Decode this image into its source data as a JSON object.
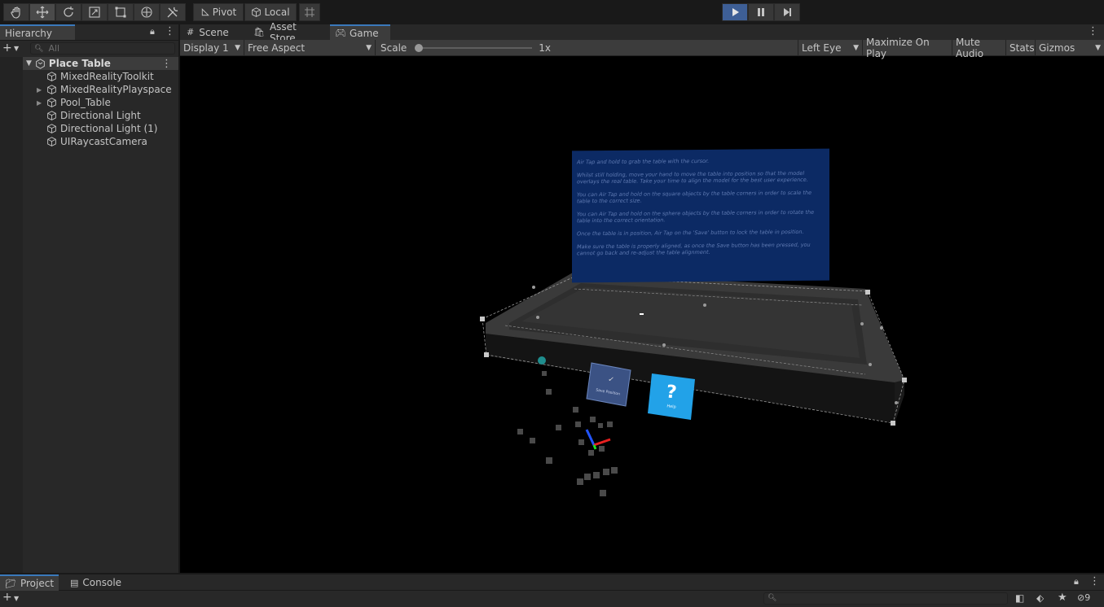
{
  "toolbar": {
    "pivot_label": "Pivot",
    "local_label": "Local"
  },
  "hierarchy": {
    "tab_label": "Hierarchy",
    "search_placeholder": "All",
    "scene_name": "Place Table",
    "items": [
      {
        "label": "MixedRealityToolkit",
        "expandable": false
      },
      {
        "label": "MixedRealityPlayspace",
        "expandable": true
      },
      {
        "label": "Pool_Table",
        "expandable": true
      },
      {
        "label": "Directional Light",
        "expandable": false
      },
      {
        "label": "Directional Light (1)",
        "expandable": false
      },
      {
        "label": "UIRaycastCamera",
        "expandable": false
      }
    ]
  },
  "tabs": {
    "scene": "Scene",
    "asset_store": "Asset Store",
    "game": "Game"
  },
  "gamebar": {
    "display": "Display 1",
    "aspect": "Free Aspect",
    "scale_label": "Scale",
    "scale_value": "1x",
    "scale_fraction": 0.0,
    "eye": "Left Eye",
    "maximize": "Maximize On Play",
    "mute": "Mute Audio",
    "stats": "Stats",
    "gizmos": "Gizmos"
  },
  "instructions": [
    "Air Tap and hold to grab the table with the cursor.",
    "Whilst still holding, move your hand to move the table into position so that the model overlays the real table. Take your time to align the model for the best user experience.",
    "You can Air Tap and hold on the square objects by the table corners in order to scale the table to the correct size.",
    "You can Air Tap and hold on the sphere objects by the table corners in order to rotate the table into the correct orientation.",
    "Once the table is in position, Air Tap on the 'Save' button to lock the table in position.",
    "Make sure the table is properly aligned, as once the Save button has been pressed, you cannot go back and re-adjust the table alignment."
  ],
  "buttons3d": {
    "save_label": "Save Position",
    "help_label": "Help",
    "help_glyph": "?",
    "check_glyph": "✓"
  },
  "bottom": {
    "project_tab": "Project",
    "console_tab": "Console",
    "hidden_count": "9"
  }
}
